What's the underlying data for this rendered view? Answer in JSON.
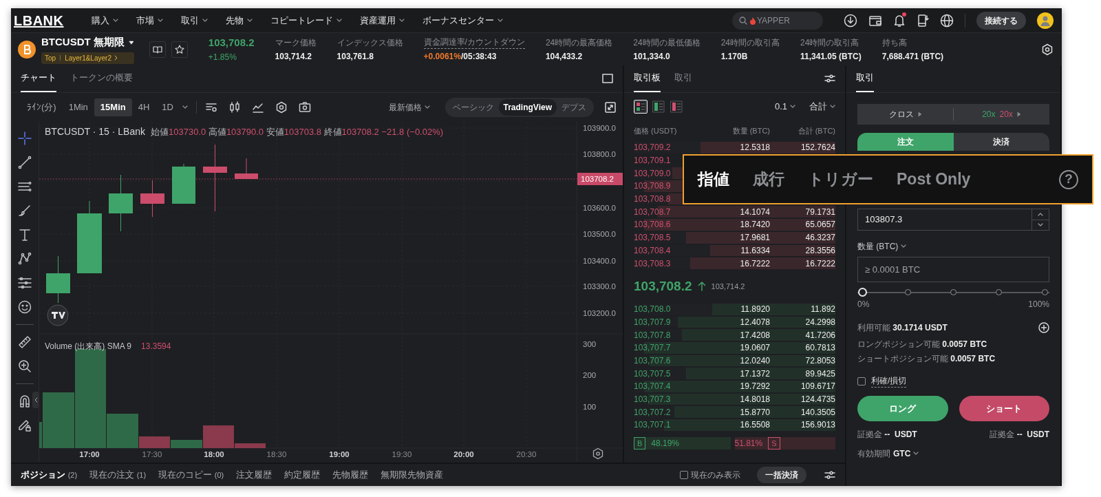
{
  "nav": {
    "logo": "LBANK",
    "menus": [
      {
        "label": "購入"
      },
      {
        "label": "市場"
      },
      {
        "label": "取引"
      },
      {
        "label": "先物"
      },
      {
        "label": "コピートレード"
      },
      {
        "label": "資産運用"
      },
      {
        "label": "ボーナスセンター"
      }
    ],
    "search": {
      "placeholder": "YAPPER"
    },
    "notifications_unread": true,
    "connect_button": "接続する"
  },
  "ticker": {
    "symbol": "BTCUSDT 無期限",
    "tag": "Top",
    "category": "Layer1&Layer2",
    "last_price": "103,708.2",
    "change": "+1.85%",
    "stats": [
      {
        "kind": "plain",
        "label": "マーク価格",
        "value": "103,714.2"
      },
      {
        "kind": "plain",
        "label": "インデックス価格",
        "value": "103,761.8"
      },
      {
        "kind": "funding",
        "label": "資金調達率/カウントダウン",
        "value": "+0.0061%",
        "extra": "/05:38:43"
      },
      {
        "kind": "plain",
        "label": "24時間の最高価格",
        "value": "104,433.2"
      },
      {
        "kind": "plain",
        "label": "24時間の最低価格",
        "value": "101,334.0"
      },
      {
        "kind": "plain",
        "label": "24時間の取引高",
        "value": "1.170B"
      },
      {
        "kind": "plain",
        "label": "24時間の取引高",
        "value": "11,341.05 (BTC)"
      },
      {
        "kind": "plain",
        "label": "持ち高",
        "value": "7,688.471 (BTC)"
      }
    ]
  },
  "chart_panel": {
    "tabs": [
      {
        "label": "チャート",
        "selected": true
      },
      {
        "label": "トークンの概要",
        "selected": false
      }
    ],
    "intervals": [
      {
        "label": "ﾗｲﾝ(分)",
        "selected": false
      },
      {
        "label": "1Min",
        "selected": false
      },
      {
        "label": "15Min",
        "selected": true
      },
      {
        "label": "4H",
        "selected": false
      },
      {
        "label": "1D",
        "selected": false
      }
    ],
    "price_source": "最新価格",
    "views": [
      {
        "label": "ベーシック",
        "selected": false
      },
      {
        "label": "TradingView",
        "selected": true
      },
      {
        "label": "デプス",
        "selected": false
      }
    ],
    "legend": {
      "title": "BTCUSDT · 15 · LBank",
      "fields": [
        {
          "label": "始値",
          "value": "103730.0"
        },
        {
          "label": "高値",
          "value": "103790.0"
        },
        {
          "label": "安値",
          "value": "103703.8"
        },
        {
          "label": "終値",
          "value": "103708.2"
        }
      ],
      "change": "−21.8 (−0.02%)"
    },
    "price_axis": [
      "103900.0",
      "103800.0",
      "103600.0",
      "103500.0",
      "103400.0",
      "103300.0",
      "103200.0"
    ],
    "last_price_tag": "103708.2",
    "volume": {
      "label": "Volume (出来高) SMA 9",
      "value": "13.3594",
      "axis": [
        "300",
        "200",
        "100"
      ]
    },
    "time_axis": [
      {
        "label": "17:00",
        "kind": "major"
      },
      {
        "label": "17:30",
        "kind": "minor"
      },
      {
        "label": "18:00",
        "kind": "major"
      },
      {
        "label": "18:30",
        "kind": "minor"
      },
      {
        "label": "19:00",
        "kind": "major"
      },
      {
        "label": "19:30",
        "kind": "minor"
      },
      {
        "label": "20:00",
        "kind": "major"
      },
      {
        "label": "20:30",
        "kind": "minor"
      }
    ]
  },
  "order_book": {
    "tabs": [
      {
        "label": "取引板",
        "selected": true
      },
      {
        "label": "取引",
        "selected": false
      }
    ],
    "layouts": [
      {
        "kind": "both",
        "selected": true
      },
      {
        "kind": "bids",
        "selected": false
      },
      {
        "kind": "asks",
        "selected": false
      }
    ],
    "precision": "0.1",
    "total_mode": "合計",
    "columns": [
      "価格 (USDT)",
      "数量 (BTC)",
      "合計 (BTC)"
    ],
    "asks": [
      {
        "price": "103,709.2",
        "quantity": "12.5318",
        "total": "152.7624",
        "level": 0.67
      },
      {
        "price": "103,709.1"
      },
      {
        "price": "103,709.0",
        "level": 0.81
      },
      {
        "price": "103,708.9",
        "level": 0.95
      },
      {
        "price": "103,708.8",
        "level": 0.83
      },
      {
        "price": "103,708.7",
        "quantity": "14.1074",
        "total": "79.1731",
        "level": 0.88
      },
      {
        "price": "103,708.6",
        "quantity": "18.7420",
        "total": "65.0657",
        "level": 0.95
      },
      {
        "price": "103,708.5",
        "quantity": "17.9681",
        "total": "46.3237",
        "level": 0.74
      },
      {
        "price": "103,708.4",
        "quantity": "11.6334",
        "total": "28.3556",
        "level": 0.62
      },
      {
        "price": "103,708.3",
        "quantity": "16.7222",
        "total": "16.7222",
        "level": 0.72
      }
    ],
    "last_price": "103,708.2",
    "mark_price": "103,714.2",
    "bids": [
      {
        "price": "103,708.0",
        "quantity": "11.8920",
        "total": "11.892",
        "level": 0.61
      },
      {
        "price": "103,707.9",
        "quantity": "12.4078",
        "total": "24.2998",
        "level": 0.78
      },
      {
        "price": "103,707.8",
        "quantity": "17.4208",
        "total": "41.7206",
        "level": 0.76
      },
      {
        "price": "103,707.7",
        "quantity": "19.0607",
        "total": "60.7813",
        "level": 0.95
      },
      {
        "price": "103,707.6",
        "quantity": "12.0240",
        "total": "72.8053",
        "level": 0.92
      },
      {
        "price": "103,707.5",
        "quantity": "17.1372",
        "total": "89.9425",
        "level": 0.74
      },
      {
        "price": "103,707.4",
        "quantity": "19.7292",
        "total": "109.6717",
        "level": 0.95
      },
      {
        "price": "103,707.3",
        "quantity": "14.8018",
        "total": "124.4735",
        "level": 0.93
      },
      {
        "price": "103,707.2",
        "quantity": "15.8770",
        "total": "140.3505",
        "level": 0.8
      },
      {
        "price": "103,707.1",
        "quantity": "16.5508",
        "total": "156.9013",
        "level": 0.85
      }
    ],
    "ratio": {
      "buy_label": "B",
      "buy_ratio": "48.19%",
      "sell_ratio": "51.81%",
      "sell_label": "S",
      "level": 0.48
    }
  },
  "trade_panel": {
    "tabs": [
      {
        "label": "取引",
        "selected": true
      }
    ],
    "margin_mode": "クロス",
    "leverage_long": "20x",
    "leverage_short": "20x",
    "sides": [
      {
        "label": "注文",
        "selected": true
      },
      {
        "label": "決済",
        "selected": false
      }
    ],
    "price_value": "103807.3",
    "qty_label": "数量 (BTC)",
    "qty_placeholder": "≥ 0.0001 BTC",
    "slider": {
      "level": 0,
      "min_label": "0%",
      "max_label": "100%"
    },
    "available": {
      "label": "利用可能",
      "value": "30.1714 USDT"
    },
    "long_max": {
      "label": "ロングポジション可能",
      "value": "0.0057 BTC"
    },
    "short_max": {
      "label": "ショートポジション可能",
      "value": "0.0057 BTC"
    },
    "tpsl": {
      "label": "利確/損切",
      "checked": false
    },
    "long_button": "ロング",
    "short_button": "ショート",
    "margins": [
      {
        "label": "証拠金",
        "value": "--",
        "unit": "USDT"
      },
      {
        "label": "証拠金",
        "value": "--",
        "unit": "USDT"
      }
    ],
    "tif": {
      "label": "有効期間",
      "value": "GTC"
    }
  },
  "bottom_bar": {
    "tabs": [
      {
        "label": "ポジション",
        "count": "(2)",
        "selected": true
      },
      {
        "label": "現在の注文",
        "count": "(1)",
        "selected": false
      },
      {
        "label": "現在のコピー",
        "count": "(0)",
        "selected": false
      },
      {
        "label": "注文履歴",
        "selected": false
      },
      {
        "label": "約定履歴",
        "selected": false
      },
      {
        "label": "先物履歴",
        "selected": false
      },
      {
        "label": "無期限先物資産",
        "selected": false
      }
    ],
    "current_only": {
      "label": "現在のみ表示",
      "checked": false
    },
    "close_all_button": "一括決済"
  },
  "callout": {
    "tabs": [
      {
        "label": "指値",
        "selected": true
      },
      {
        "label": "成行",
        "selected": false
      },
      {
        "label": "トリガー",
        "selected": false
      },
      {
        "label": "Post Only",
        "selected": false
      }
    ],
    "help": "?"
  }
}
